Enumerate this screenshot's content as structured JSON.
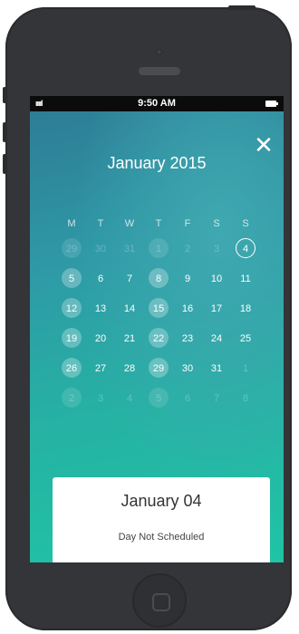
{
  "statusbar": {
    "signal": "ııııl",
    "time": "9:50 AM"
  },
  "header": {
    "close_label": "✕",
    "month_title": "January 2015"
  },
  "calendar": {
    "weekdays": [
      "M",
      "T",
      "W",
      "T",
      "F",
      "S",
      "S"
    ],
    "weeks": [
      [
        {
          "label": "29",
          "state": "faded-dot"
        },
        {
          "label": "30",
          "state": "faded"
        },
        {
          "label": "31",
          "state": "faded"
        },
        {
          "label": "1",
          "state": "faded-dot"
        },
        {
          "label": "2",
          "state": "faded"
        },
        {
          "label": "3",
          "state": "faded"
        },
        {
          "label": "4",
          "state": "selected"
        }
      ],
      [
        {
          "label": "5",
          "state": "dot"
        },
        {
          "label": "6",
          "state": "normal"
        },
        {
          "label": "7",
          "state": "normal"
        },
        {
          "label": "8",
          "state": "dot"
        },
        {
          "label": "9",
          "state": "normal"
        },
        {
          "label": "10",
          "state": "normal"
        },
        {
          "label": "11",
          "state": "normal"
        }
      ],
      [
        {
          "label": "12",
          "state": "dot"
        },
        {
          "label": "13",
          "state": "normal"
        },
        {
          "label": "14",
          "state": "normal"
        },
        {
          "label": "15",
          "state": "dot"
        },
        {
          "label": "16",
          "state": "normal"
        },
        {
          "label": "17",
          "state": "normal"
        },
        {
          "label": "18",
          "state": "normal"
        }
      ],
      [
        {
          "label": "19",
          "state": "dot"
        },
        {
          "label": "20",
          "state": "normal"
        },
        {
          "label": "21",
          "state": "normal"
        },
        {
          "label": "22",
          "state": "dot"
        },
        {
          "label": "23",
          "state": "normal"
        },
        {
          "label": "24",
          "state": "normal"
        },
        {
          "label": "25",
          "state": "normal"
        }
      ],
      [
        {
          "label": "26",
          "state": "dot"
        },
        {
          "label": "27",
          "state": "normal"
        },
        {
          "label": "28",
          "state": "normal"
        },
        {
          "label": "29",
          "state": "dot"
        },
        {
          "label": "30",
          "state": "normal"
        },
        {
          "label": "31",
          "state": "normal"
        },
        {
          "label": "1",
          "state": "faded"
        }
      ],
      [
        {
          "label": "2",
          "state": "faded-dot"
        },
        {
          "label": "3",
          "state": "faded"
        },
        {
          "label": "4",
          "state": "faded"
        },
        {
          "label": "5",
          "state": "faded-dot"
        },
        {
          "label": "6",
          "state": "faded"
        },
        {
          "label": "7",
          "state": "faded"
        },
        {
          "label": "8",
          "state": "faded"
        }
      ]
    ]
  },
  "detail_card": {
    "date": "January 04",
    "status": "Day Not Scheduled"
  },
  "colors": {
    "phone_body": "#333538",
    "gradient_top": "#2e7a95",
    "gradient_bottom": "#1fc4a5",
    "card_bg": "#ffffff"
  },
  "icons": {
    "close": "close-icon",
    "wifi": "wifi-icon",
    "battery": "battery-icon",
    "home": "home-button-icon"
  }
}
